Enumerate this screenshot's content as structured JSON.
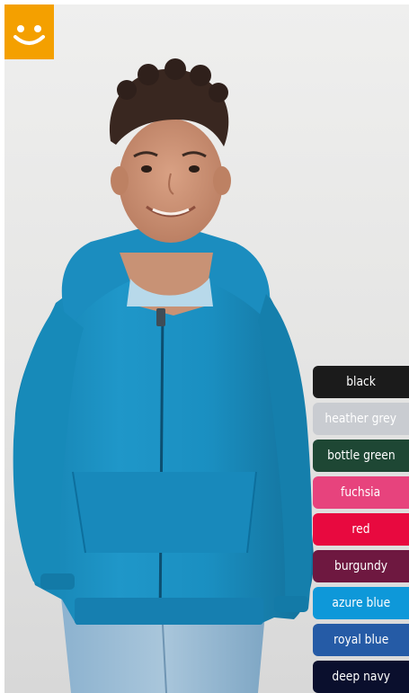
{
  "logo": {
    "icon": "smiley-icon",
    "color": "#f4a000"
  },
  "product": {
    "image": "boy-wearing-azure-blue-zip-hoodie",
    "garment_color": "#1e93c5"
  },
  "colors": [
    {
      "label": "black",
      "hex": "#1b1b1b",
      "text_color": "#ffffff"
    },
    {
      "label": "heather grey",
      "hex": "#c9ccd1",
      "text_color": "#ffffff"
    },
    {
      "label": "bottle green",
      "hex": "#1e4734",
      "text_color": "#ffffff"
    },
    {
      "label": "fuchsia",
      "hex": "#e7437d",
      "text_color": "#ffffff"
    },
    {
      "label": "red",
      "hex": "#e8093f",
      "text_color": "#ffffff"
    },
    {
      "label": "burgundy",
      "hex": "#6e1840",
      "text_color": "#ffffff"
    },
    {
      "label": "azure blue",
      "hex": "#0e98d9",
      "text_color": "#ffffff"
    },
    {
      "label": "royal blue",
      "hex": "#255ba6",
      "text_color": "#ffffff"
    },
    {
      "label": "deep navy",
      "hex": "#0a0f2d",
      "text_color": "#ffffff"
    }
  ]
}
